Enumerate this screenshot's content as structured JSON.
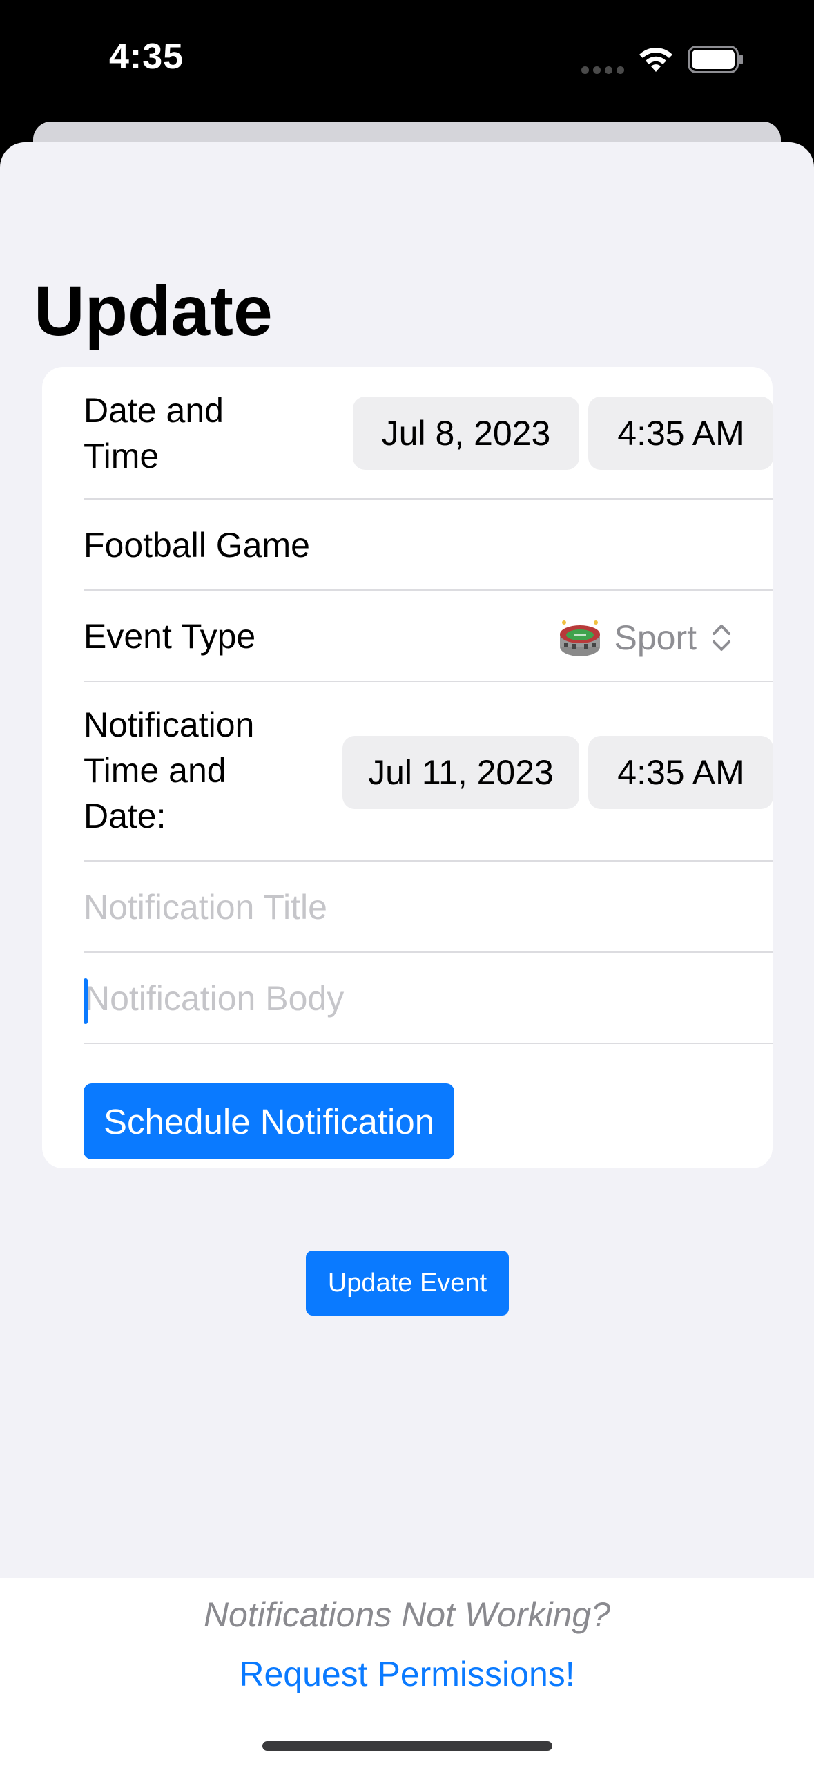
{
  "status_bar": {
    "time": "4:35"
  },
  "page": {
    "title": "Update"
  },
  "form": {
    "date_time": {
      "label_line1": "Date and",
      "label_line2": "Time",
      "date": "Jul 8, 2023",
      "time": "4:35 AM"
    },
    "event_name": "Football Game",
    "event_type": {
      "label": "Event Type",
      "selected": "Sport",
      "icon": "stadium-icon"
    },
    "notification_date_time": {
      "label_line1": "Notification",
      "label_line2": "Time and",
      "label_line3": "Date:",
      "date": "Jul 11, 2023",
      "time": "4:35 AM"
    },
    "notification_title": {
      "value": "",
      "placeholder": "Notification Title"
    },
    "notification_body": {
      "value": "",
      "placeholder": "Notification Body"
    },
    "schedule_label": "Schedule Notification"
  },
  "actions": {
    "update_label": "Update Event"
  },
  "footer": {
    "note": "Notifications Not Working?",
    "link": "Request Permissions!"
  },
  "colors": {
    "accent": "#0A7AFF",
    "background": "#F2F2F7",
    "card": "#FFFFFF",
    "pill": "#EEEEF0",
    "placeholder": "#C5C5C9"
  }
}
